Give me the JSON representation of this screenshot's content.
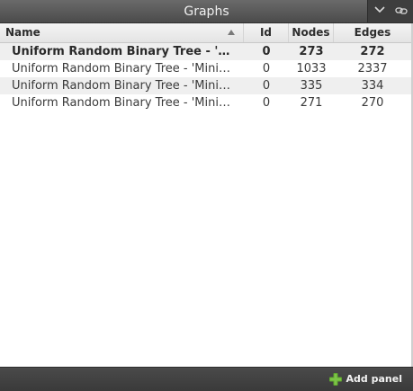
{
  "window": {
    "title": "Graphs",
    "collapse_icon": "chevron-down-icon",
    "link_icon": "link-icon"
  },
  "table": {
    "columns": {
      "name": "Name",
      "id": "Id",
      "nodes": "Nodes",
      "edges": "Edges"
    },
    "sort_icon": "sort-ascending-icon",
    "rows": [
      {
        "name": "Uniform Random Binary Tree - 'Mini…",
        "id": "0",
        "nodes": "273",
        "edges": "272",
        "selected": true
      },
      {
        "name": "Uniform Random Binary Tree - 'Mini…",
        "id": "0",
        "nodes": "1033",
        "edges": "2337",
        "selected": false
      },
      {
        "name": "Uniform Random Binary Tree - 'Mini…",
        "id": "0",
        "nodes": "335",
        "edges": "334",
        "selected": false
      },
      {
        "name": "Uniform Random Binary Tree - 'Mini…",
        "id": "0",
        "nodes": "271",
        "edges": "270",
        "selected": false
      }
    ]
  },
  "footer": {
    "add_panel_label": "Add panel",
    "add_panel_icon": "plus-icon",
    "accent_color": "#5fa82e"
  }
}
